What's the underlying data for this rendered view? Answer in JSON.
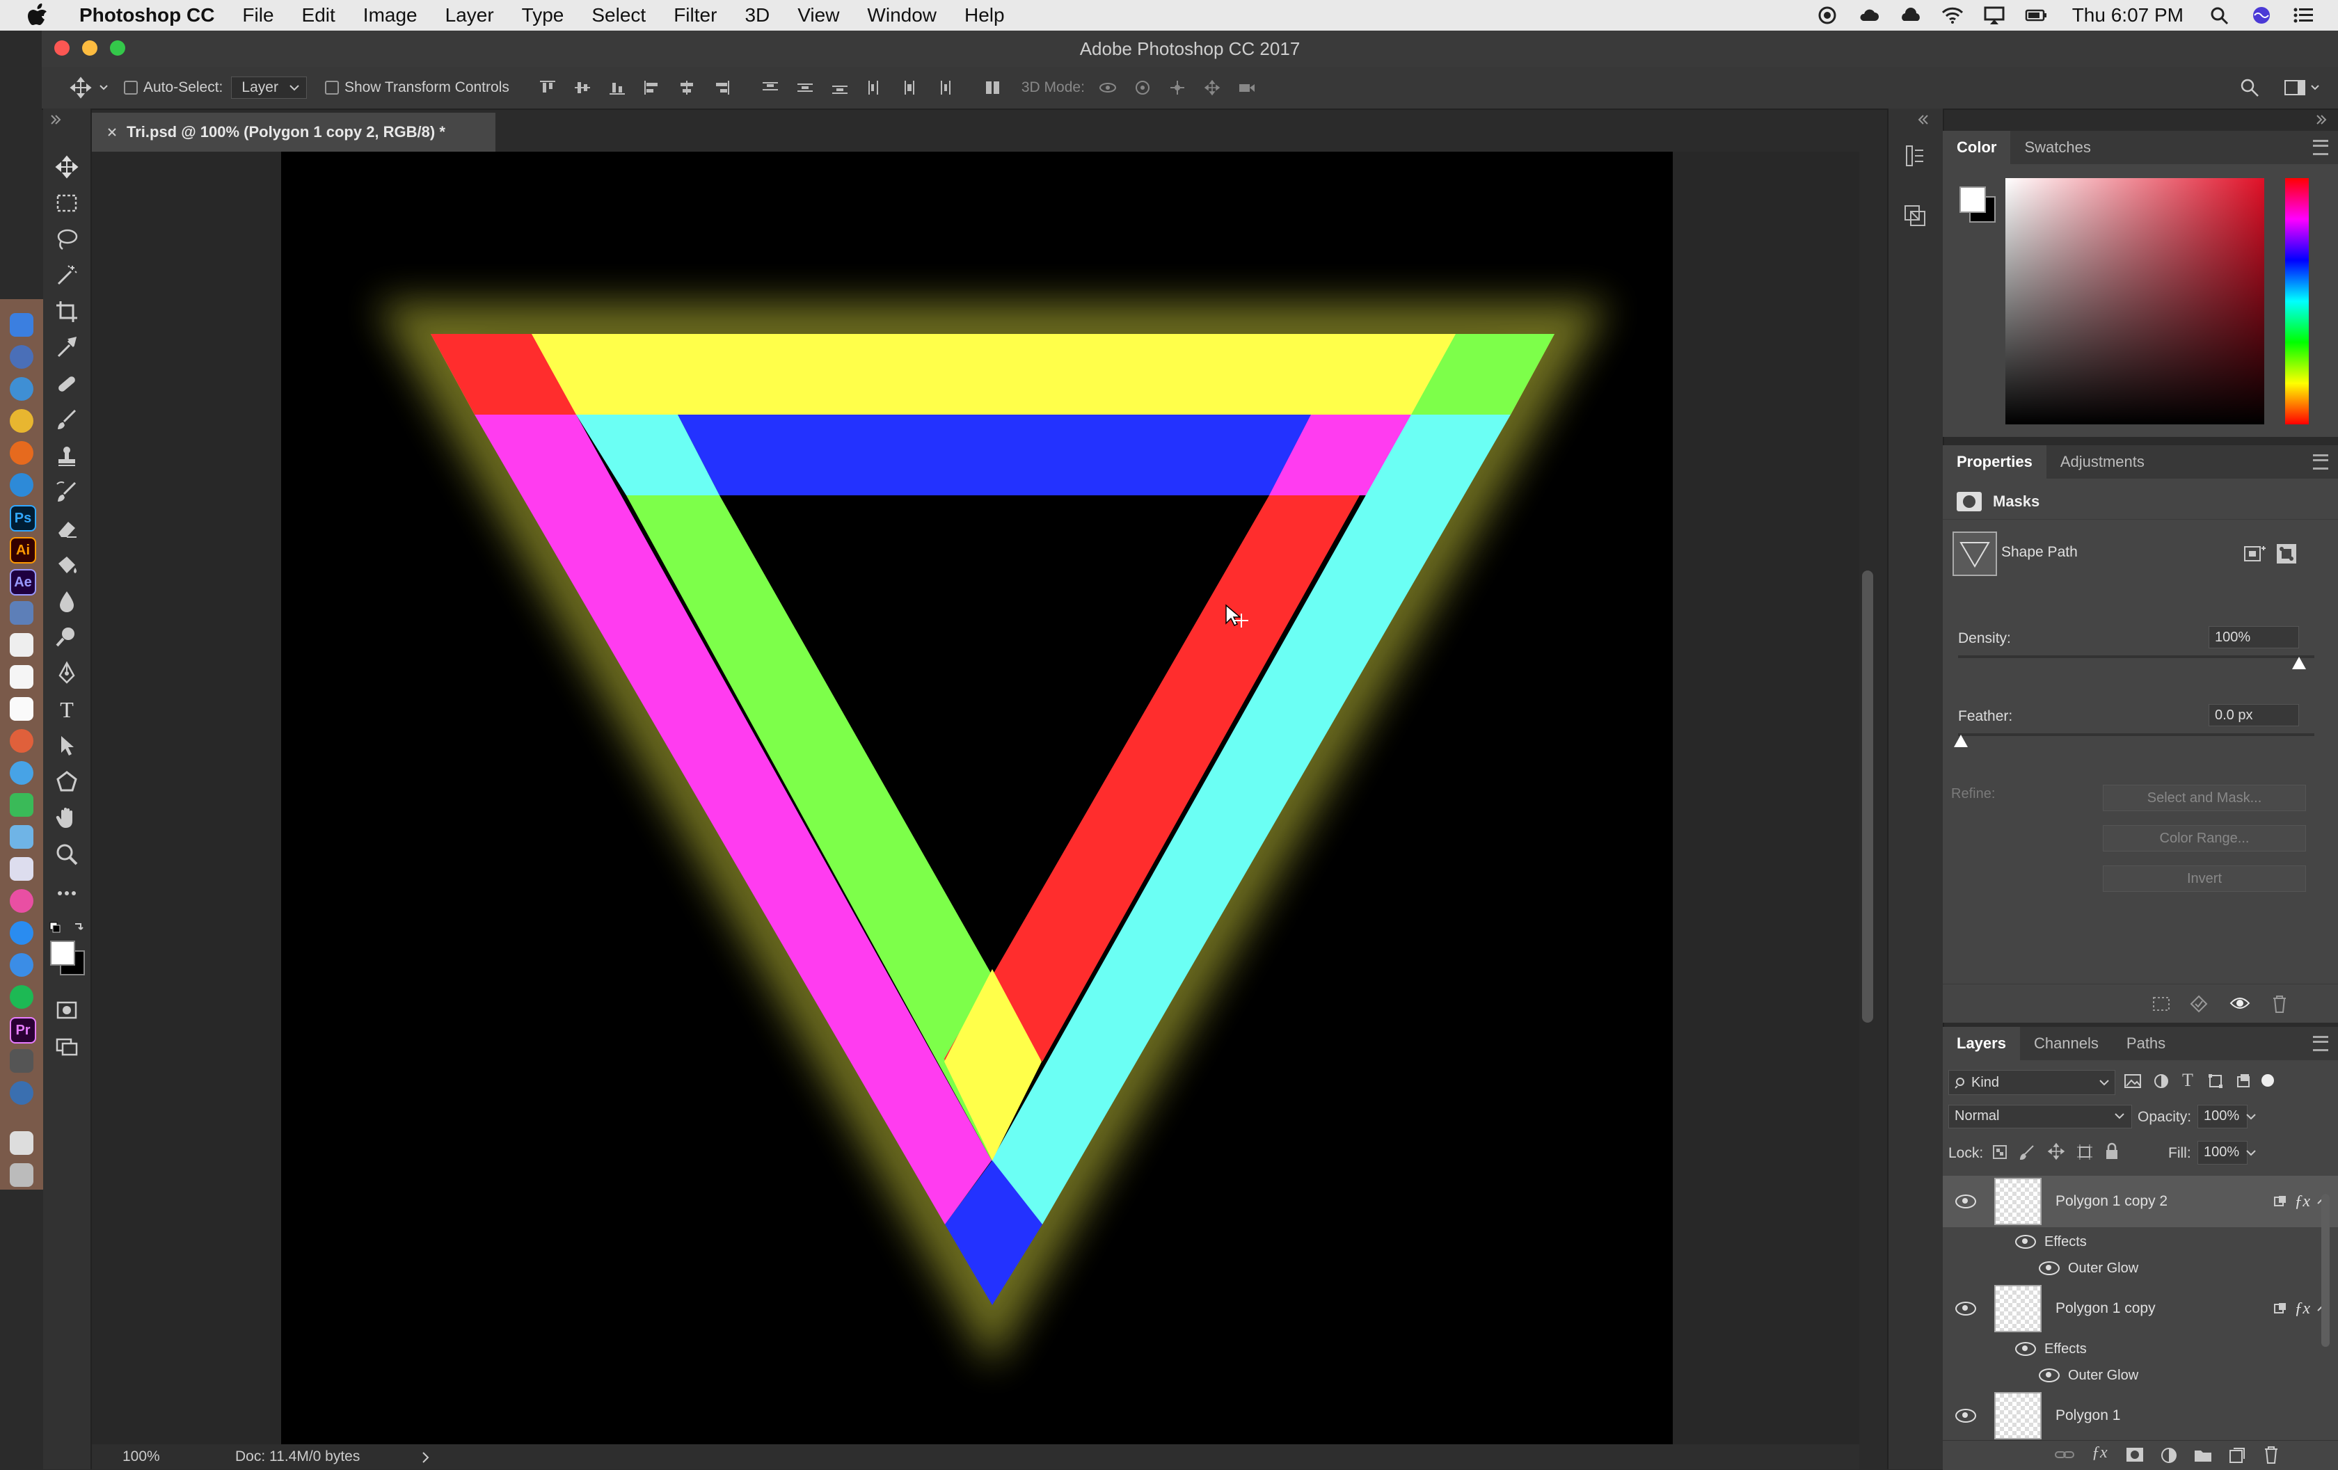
{
  "menubar": {
    "app_name": "Photoshop CC",
    "items": [
      "File",
      "Edit",
      "Image",
      "Layer",
      "Type",
      "Select",
      "Filter",
      "3D",
      "View",
      "Window",
      "Help"
    ],
    "clock": "Thu 6:07 PM"
  },
  "window": {
    "title": "Adobe Photoshop CC 2017"
  },
  "options_bar": {
    "auto_select_label": "Auto-Select:",
    "auto_select_value": "Layer",
    "show_transform_label": "Show Transform Controls",
    "mode_3d_label": "3D Mode:"
  },
  "document": {
    "tab_label": "Tri.psd @ 100% (Polygon 1 copy 2, RGB/8) *",
    "zoom": "100%",
    "doc_info": "Doc: 11.4M/0 bytes"
  },
  "color_panel": {
    "tabs": [
      "Color",
      "Swatches"
    ]
  },
  "properties_panel": {
    "tabs": [
      "Properties",
      "Adjustments"
    ],
    "section_label": "Masks",
    "shape_path_label": "Shape Path",
    "density_label": "Density:",
    "density_value": "100%",
    "feather_label": "Feather:",
    "feather_value": "0.0 px",
    "refine_label": "Refine:",
    "select_mask_button": "Select and Mask...",
    "color_range_button": "Color Range...",
    "invert_button": "Invert"
  },
  "layers_panel": {
    "tabs": [
      "Layers",
      "Channels",
      "Paths"
    ],
    "kind_filter": "Kind",
    "blend_mode": "Normal",
    "opacity_label": "Opacity:",
    "opacity_value": "100%",
    "lock_label": "Lock:",
    "fill_label": "Fill:",
    "fill_value": "100%",
    "layers": [
      {
        "name": "Polygon 1 copy 2",
        "effects_label": "Effects",
        "effect": "Outer Glow"
      },
      {
        "name": "Polygon 1 copy",
        "effects_label": "Effects",
        "effect": "Outer Glow"
      },
      {
        "name": "Polygon 1"
      }
    ]
  },
  "colors": {
    "red": "#ff2d2d",
    "yellow": "#ffff4a",
    "green": "#7dff4a",
    "cyan": "#6bfff4",
    "magenta": "#ff3cf0",
    "blue": "#2332ff"
  },
  "dock_icons": [
    "finder-icon",
    "chrome-icon",
    "firefox-icon",
    "safari-icon",
    "photoshop-icon",
    "illustrator-icon",
    "after-effects-icon",
    "itunes-icon",
    "spotify-icon",
    "premiere-icon",
    "trash-icon"
  ],
  "dock_labels": {
    "ps": "Ps",
    "ai": "Ai",
    "ae": "Ae",
    "pr": "Pr"
  },
  "tool_icons": [
    "move-tool-icon",
    "marquee-tool-icon",
    "lasso-tool-icon",
    "magic-wand-tool-icon",
    "crop-tool-icon",
    "eyedropper-tool-icon",
    "healing-brush-tool-icon",
    "brush-tool-icon",
    "stamp-tool-icon",
    "history-brush-tool-icon",
    "eraser-tool-icon",
    "paint-bucket-tool-icon",
    "blur-tool-icon",
    "dodge-tool-icon",
    "pen-tool-icon",
    "type-tool-icon",
    "path-selection-tool-icon",
    "shape-tool-icon",
    "hand-tool-icon",
    "zoom-tool-icon",
    "more-tools-icon"
  ],
  "tool_labels": {
    "type": "T"
  }
}
